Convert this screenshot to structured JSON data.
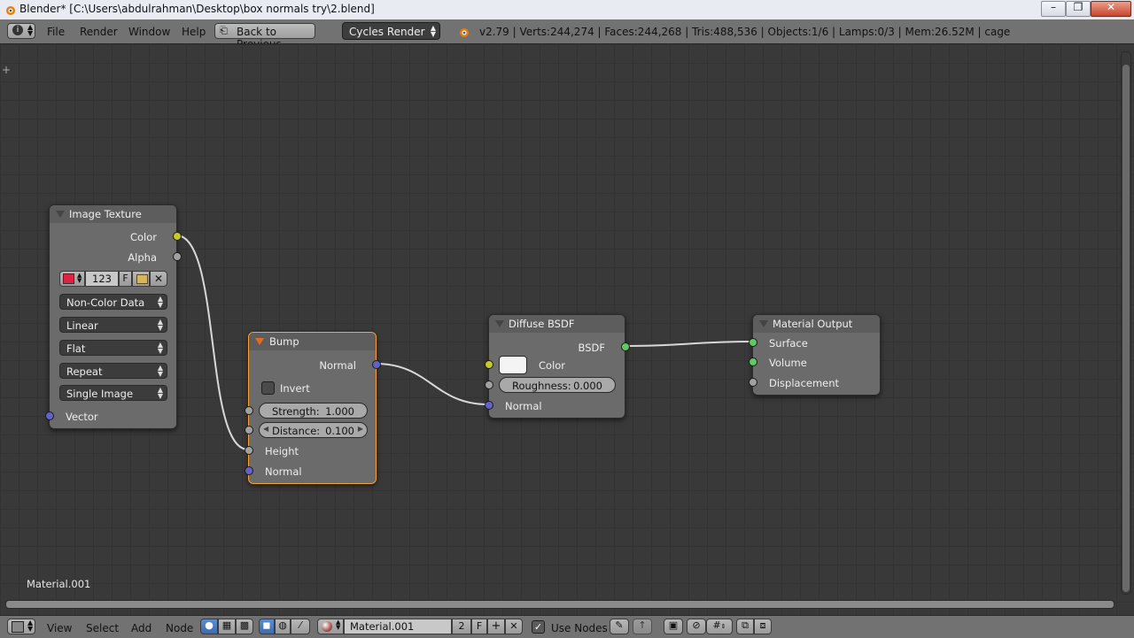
{
  "window": {
    "title": "Blender* [C:\\Users\\abdulrahman\\Desktop\\box normals try\\2.blend]",
    "minimize_icon": "minimize-icon",
    "restore_icon": "restore-icon",
    "close_icon": "close-icon"
  },
  "info_header": {
    "menus": [
      "File",
      "Render",
      "Window",
      "Help"
    ],
    "back_button": "Back to Previous",
    "render_engine": "Cycles Render",
    "stats": "v2.79 | Verts:244,274 | Faces:244,268 | Tris:488,536 | Objects:1/6 | Lamps:0/3 | Mem:26.52M | cage"
  },
  "editor": {
    "material_label": "Material.001",
    "nodes": {
      "image_texture": {
        "title": "Image Texture",
        "outputs": [
          "Color",
          "Alpha"
        ],
        "image_users": "123",
        "fake_user": "F",
        "color_space": "Non-Color Data",
        "interpolation": "Linear",
        "projection": "Flat",
        "extension": "Repeat",
        "source": "Single Image",
        "input": "Vector"
      },
      "bump": {
        "title": "Bump",
        "output": "Normal",
        "invert_label": "Invert",
        "strength_label": "Strength:",
        "strength_value": "1.000",
        "distance_label": "Distance:",
        "distance_value": "0.100",
        "height_label": "Height",
        "normal_label": "Normal"
      },
      "diffuse": {
        "title": "Diffuse BSDF",
        "output": "BSDF",
        "color_label": "Color",
        "roughness_label": "Roughness:",
        "roughness_value": "0.000",
        "normal_label": "Normal"
      },
      "material_output": {
        "title": "Material Output",
        "inputs": [
          "Surface",
          "Volume",
          "Displacement"
        ]
      }
    }
  },
  "bottom_header": {
    "menus": [
      "View",
      "Select",
      "Add",
      "Node"
    ],
    "material_name": "Material.001",
    "users": "2",
    "fake_user": "F",
    "use_nodes": "Use Nodes"
  },
  "colors": {
    "socket_color": "#c8c829",
    "socket_shader": "#63c763",
    "socket_vector": "#6363c7",
    "socket_value": "#a1a1a1",
    "active_node_border": "#f2a33a"
  }
}
